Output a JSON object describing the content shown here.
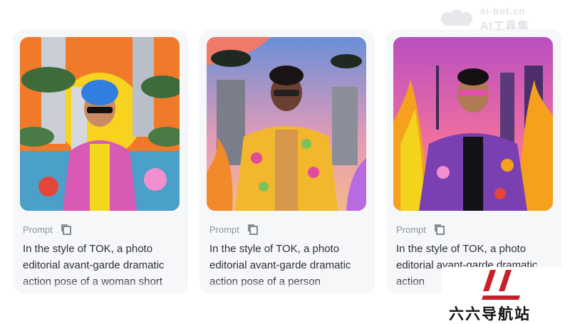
{
  "watermark": {
    "line1": "ai-bot.cn",
    "line2": "AI工具集"
  },
  "brand": {
    "name": "六六导航站"
  },
  "cards": [
    {
      "image_alt": "Woman with blue hair in colorful patterned jacket and sunglasses",
      "prompt_label": "Prompt",
      "prompt_text": "In the style of TOK, a photo editorial avant-garde dramatic action pose of a woman short"
    },
    {
      "image_alt": "Man in yellow floral jacket and sunglasses",
      "prompt_label": "Prompt",
      "prompt_text": "In the style of TOK, a photo editorial avant-garde dramatic action pose of a person"
    },
    {
      "image_alt": "Man in purple floral jacket with pink sunglasses among flames",
      "prompt_label": "Prompt",
      "prompt_text": "In the style of TOK, a photo editorial avant-garde dramatic action"
    }
  ]
}
